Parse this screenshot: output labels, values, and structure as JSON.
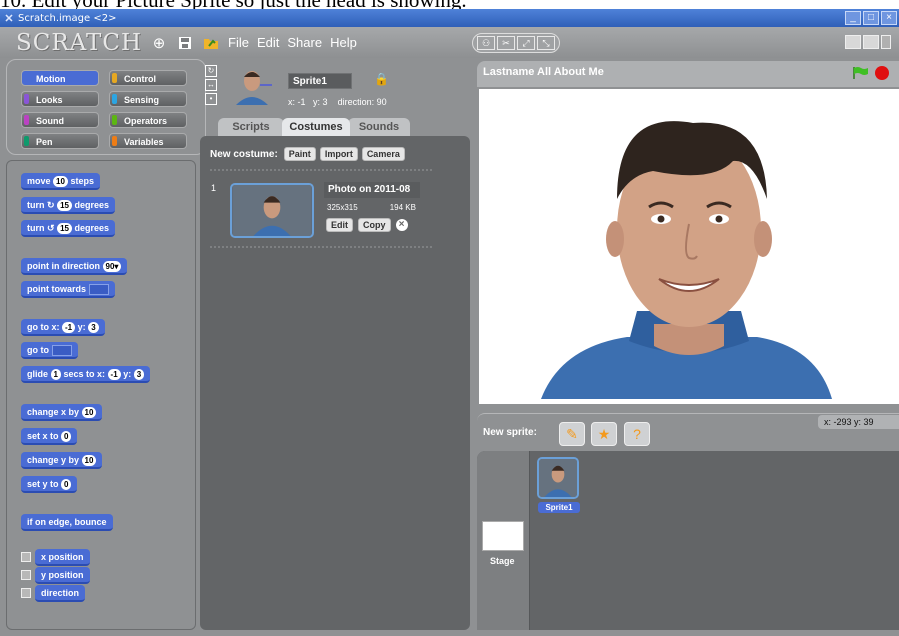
{
  "caption": "10. Edit your Picture Sprite so just the head is showing.",
  "window": {
    "title": "Scratch.image <2>",
    "buttons": [
      "_",
      "□",
      "×"
    ]
  },
  "menubar": {
    "logo": "SCRATCH",
    "menus": [
      "File",
      "Edit",
      "Share",
      "Help"
    ]
  },
  "categories": [
    {
      "label": "Motion",
      "color": "#4a6cd4",
      "selected": true
    },
    {
      "label": "Control",
      "color": "#e6a822"
    },
    {
      "label": "Looks",
      "color": "#8a55d7"
    },
    {
      "label": "Sensing",
      "color": "#2ca5e2"
    },
    {
      "label": "Sound",
      "color": "#bb42c3"
    },
    {
      "label": "Operators",
      "color": "#5cb712"
    },
    {
      "label": "Pen",
      "color": "#0e9a6c"
    },
    {
      "label": "Variables",
      "color": "#ee7d16"
    }
  ],
  "blocks": {
    "move": {
      "pre": "move",
      "val": "10",
      "post": "steps"
    },
    "turn_right": {
      "pre": "turn ↻",
      "val": "15",
      "post": "degrees"
    },
    "turn_left": {
      "pre": "turn ↺",
      "val": "15",
      "post": "degrees"
    },
    "point_dir": {
      "pre": "point in direction",
      "val": "90▾"
    },
    "point_towards": {
      "pre": "point towards"
    },
    "goto_xy": {
      "pre": "go to x:",
      "x": "-1",
      "mid": "y:",
      "y": "3"
    },
    "goto": {
      "pre": "go to"
    },
    "glide": {
      "pre": "glide",
      "secs": "1",
      "mid": "secs to x:",
      "x": "-1",
      "mid2": "y:",
      "y": "3"
    },
    "change_x": {
      "pre": "change x by",
      "val": "10"
    },
    "set_x": {
      "pre": "set x to",
      "val": "0"
    },
    "change_y": {
      "pre": "change y by",
      "val": "10"
    },
    "set_y": {
      "pre": "set y to",
      "val": "0"
    },
    "bounce": {
      "pre": "if on edge, bounce"
    },
    "x_position": "x position",
    "y_position": "y position",
    "direction": "direction"
  },
  "sprite": {
    "name": "Sprite1",
    "x_label": "x: -1",
    "y_label": "y: 3",
    "direction_label": "direction: 90"
  },
  "tabs": [
    "Scripts",
    "Costumes",
    "Sounds"
  ],
  "costumes": {
    "new_label": "New costume:",
    "buttons": [
      "Paint",
      "Import",
      "Camera"
    ],
    "item": {
      "number": "1",
      "name": "Photo on 2011-08",
      "dims": "325x315",
      "size": "194 KB",
      "edit": "Edit",
      "copy": "Copy"
    }
  },
  "stage": {
    "project_title": "Lastname All About Me"
  },
  "sprite_area": {
    "new_sprite_label": "New sprite:",
    "coords": "x: -293  y: 39",
    "stage_label": "Stage",
    "sprite_label": "Sprite1"
  }
}
